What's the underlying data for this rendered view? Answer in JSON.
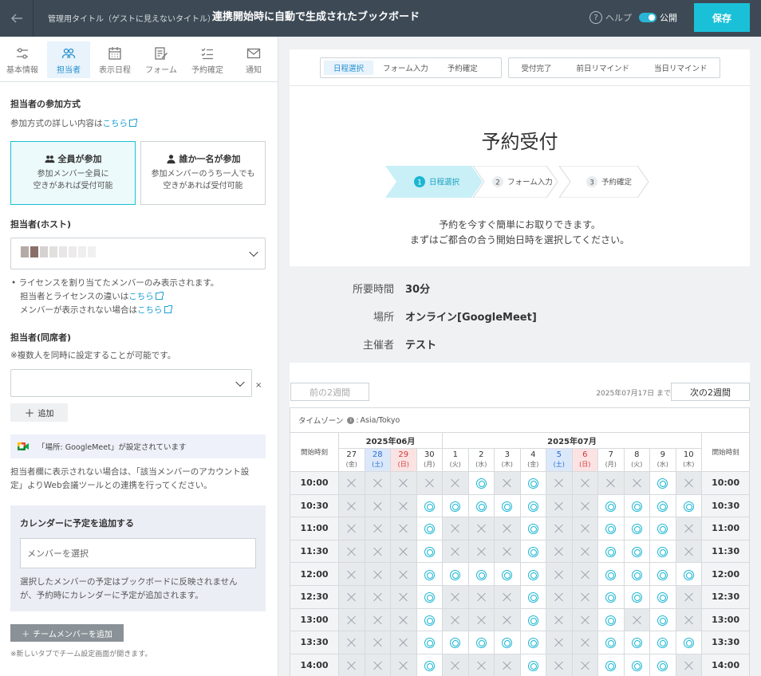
{
  "header": {
    "mgmt_title": "管理用タイトル（ゲストに見えないタイトル）",
    "board_title": "連携開始時に自動で生成されたブックボード",
    "help": "ヘルプ",
    "public": "公開",
    "save": "保存"
  },
  "nav": {
    "items": [
      {
        "label": "基本情報",
        "icon": "sliders-icon"
      },
      {
        "label": "担当者",
        "icon": "users-icon"
      },
      {
        "label": "表示日程",
        "icon": "calendar-icon"
      },
      {
        "label": "フォーム",
        "icon": "form-icon"
      },
      {
        "label": "予約確定",
        "icon": "checklist-icon"
      },
      {
        "label": "通知",
        "icon": "mail-icon"
      }
    ],
    "active": "担当者"
  },
  "left": {
    "method_title": "担当者の参加方式",
    "method_detail": "参加方式の詳しい内容は",
    "link_here": "こちら",
    "opt_all_title": "全員が参加",
    "opt_all_desc1": "参加メンバー全員に",
    "opt_all_desc2": "空きがあれば受付可能",
    "opt_one_title": "誰か一名が参加",
    "opt_one_desc1": "参加メンバーのうち一人でも",
    "opt_one_desc2": "空きがあれば受付可能",
    "host_title": "担当者(ホスト)",
    "note1": "ライセンスを割り当てたメンバーのみ表示されます。",
    "note2": "担当者とライセンスの違いは",
    "note3": "メンバーが表示されない場合は",
    "co_title": "担当者(同席者)",
    "co_note": "※複数人を同時に設定することが可能です。",
    "remove": "×",
    "add": "追加",
    "gm_notice": "「場所: GoogleMeet」が設定されています",
    "gm_desc1": "担当者欄に表示されない場合は、「該当メンバーのアカウント設",
    "gm_desc2": "定」よりWeb会議ツールとの連携を行ってください。",
    "cal_title": "カレンダーに予定を追加する",
    "cal_placeholder": "メンバーを選択",
    "cal_note1": "選択したメンバーの予定はブックボードに反映されません",
    "cal_note2": "が、予約時にカレンダーに予定が追加されます。",
    "team_btn": "チームメンバーを追加",
    "team_note": "※新しいタブでチーム設定画面が開きます。"
  },
  "preview": {
    "tabs_a": [
      "日程選択",
      "フォーム入力",
      "予約確定"
    ],
    "tabs_b": [
      "受付完了",
      "前日リマインド",
      "当日リマインド"
    ],
    "title": "予約受付",
    "steps": [
      {
        "num": "1",
        "label": "日程選択"
      },
      {
        "num": "2",
        "label": "フォーム入力"
      },
      {
        "num": "3",
        "label": "予約確定"
      }
    ],
    "intro1": "予約を今すぐ簡単にお取りできます。",
    "intro2": "まずはご都合の合う開始日時を選択してください。",
    "info": [
      {
        "key": "所要時間",
        "value": "30分"
      },
      {
        "key": "場所",
        "value": "オンライン[GoogleMeet]"
      },
      {
        "key": "主催者",
        "value": "テスト"
      }
    ],
    "prev_weeks": "前の2週間",
    "next_weeks": "次の2週間",
    "until": "2025年07月17日 まで",
    "timezone_label": "タイムゾーン",
    "timezone_value": "Asia/Tokyo",
    "start_time": "開始時刻",
    "months": [
      {
        "label": "2025年06月",
        "span": 4
      },
      {
        "label": "2025年07月",
        "span": 10
      }
    ],
    "days": [
      {
        "d": "27",
        "w": "(金)",
        "t": ""
      },
      {
        "d": "28",
        "w": "(土)",
        "t": "sat"
      },
      {
        "d": "29",
        "w": "(日)",
        "t": "sun"
      },
      {
        "d": "30",
        "w": "(月)",
        "t": ""
      },
      {
        "d": "1",
        "w": "(火)",
        "t": ""
      },
      {
        "d": "2",
        "w": "(水)",
        "t": ""
      },
      {
        "d": "3",
        "w": "(木)",
        "t": ""
      },
      {
        "d": "4",
        "w": "(金)",
        "t": ""
      },
      {
        "d": "5",
        "w": "(土)",
        "t": "sat"
      },
      {
        "d": "6",
        "w": "(日)",
        "t": "sun"
      },
      {
        "d": "7",
        "w": "(月)",
        "t": ""
      },
      {
        "d": "8",
        "w": "(火)",
        "t": ""
      },
      {
        "d": "9",
        "w": "(水)",
        "t": ""
      },
      {
        "d": "10",
        "w": "(木)",
        "t": ""
      }
    ],
    "slots": [
      {
        "time": "10:00",
        "avail": "xxxxxoxoxxxxox"
      },
      {
        "time": "10:30",
        "avail": "xxxoooooxxoooo"
      },
      {
        "time": "11:00",
        "avail": "xxxoxxxoxxooox"
      },
      {
        "time": "11:30",
        "avail": "xxxoxxxoxxooox"
      },
      {
        "time": "12:00",
        "avail": "xxxoooooxxoooo"
      },
      {
        "time": "12:30",
        "avail": "xxxoxxxoxxooox"
      },
      {
        "time": "13:00",
        "avail": "xxxoxxxoxxoxox"
      },
      {
        "time": "13:30",
        "avail": "xxxoooooxxoooo"
      },
      {
        "time": "14:00",
        "avail": "xxxoxxxoxxooox"
      }
    ]
  }
}
